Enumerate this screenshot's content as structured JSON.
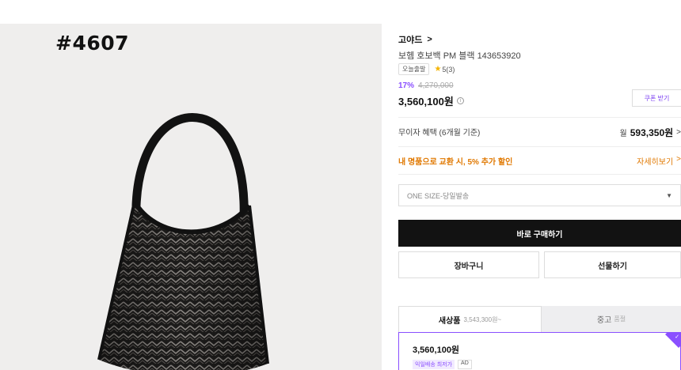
{
  "photo": {
    "tag": "#4607"
  },
  "product": {
    "brand": "고야드",
    "brand_chevron": ">",
    "name": "보헴 호보백 PM 블랙 143653920",
    "today_tag": "오늘출발",
    "rating_star": "★",
    "rating": "5(3)",
    "discount_pct": "17%",
    "original_price": "4,270,000",
    "price": "3,560,100원",
    "info_icon": "i",
    "coupon_label": "쿠폰 받기"
  },
  "interest": {
    "label": "무이자 혜택 (6개월 기준)",
    "prefix": "월",
    "value": "593,350원",
    "arrow": ">"
  },
  "exchange": {
    "text": "내 명품으로 교환 시, 5% 추가 할인",
    "more": "자세히보기",
    "arrow": ">"
  },
  "option_select": {
    "value": "ONE SIZE-당일발송",
    "arrow": "▼"
  },
  "actions": {
    "buy": "바로 구매하기",
    "cart": "장바구니",
    "gift": "선물하기"
  },
  "tabs": {
    "new_label": "새상품",
    "new_sub": "3,543,300원~",
    "used_label": "중고",
    "used_sub": "품절"
  },
  "offer_card": {
    "price": "3,560,100원",
    "tag1": "익일배송 최저가",
    "tag2": "AD",
    "check": "✓"
  },
  "colors": {
    "accent": "#8a4fff",
    "orange": "#e07800",
    "dark_button": "#121212"
  }
}
